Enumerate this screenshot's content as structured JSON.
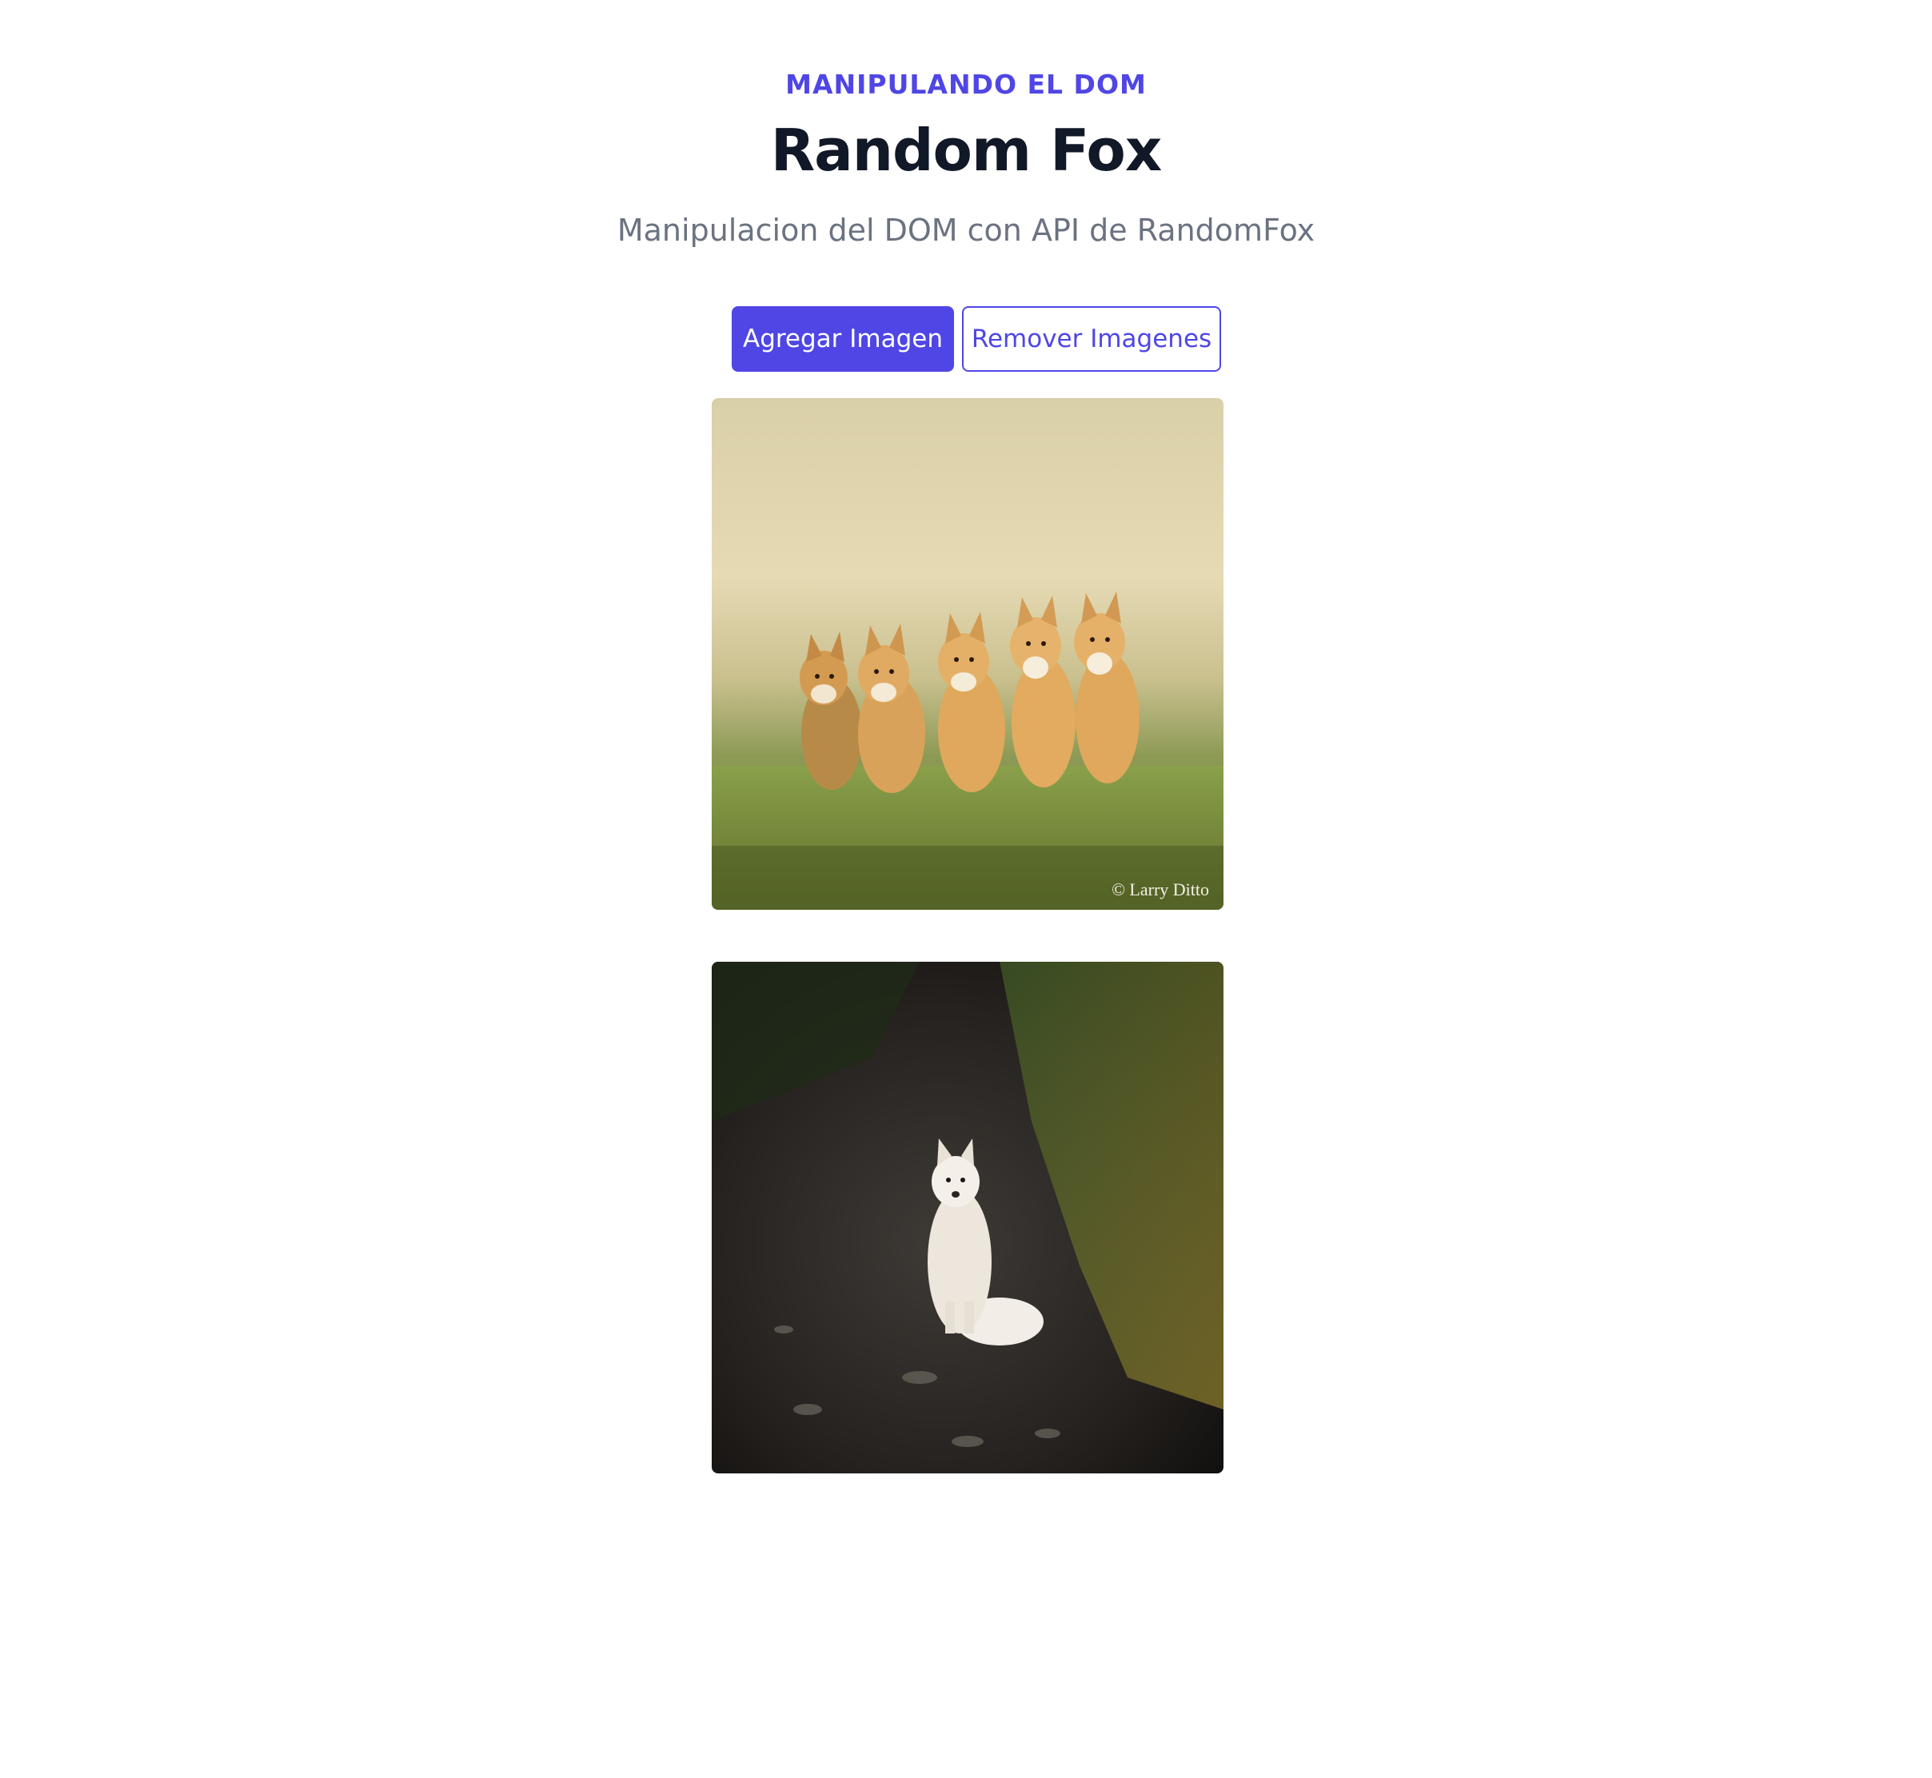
{
  "header": {
    "eyebrow": "MANIPULANDO EL DOM",
    "title": "Random Fox",
    "subtitle": "Manipulacion del DOM con API de RandomFox"
  },
  "actions": {
    "add_label": "Agregar Imagen",
    "remove_label": "Remover Imagenes"
  },
  "images": [
    {
      "alt": "fox-kits-on-grass",
      "watermark": "© Larry Ditto"
    },
    {
      "alt": "arctic-fox-on-path"
    }
  ],
  "colors": {
    "accent": "#4f46e5",
    "title": "#111827",
    "subtitle": "#6b7280"
  }
}
